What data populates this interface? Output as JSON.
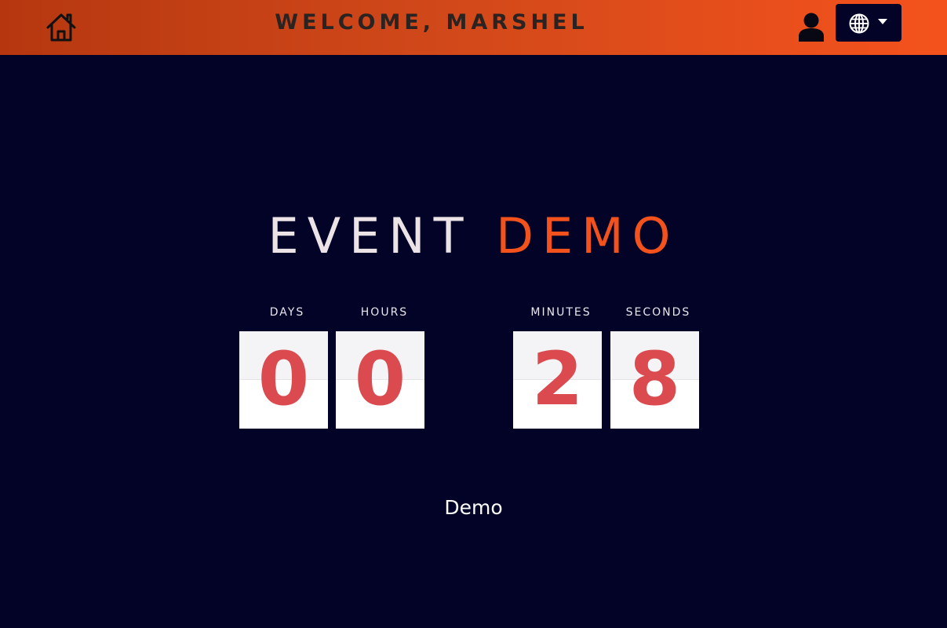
{
  "header": {
    "welcome_text": "WELCOME, MARSHEL",
    "home_icon": "home-icon",
    "user_icon": "user-icon",
    "language_icon": "globe-icon",
    "gradient_start": "#b6370f",
    "gradient_end": "#f4521c"
  },
  "event": {
    "title_part1": "EVENT",
    "title_part2": "DEMO",
    "accent_color": "#f4521c",
    "subtitle": "Demo"
  },
  "countdown": {
    "days_label": "DAYS",
    "hours_label": "HOURS",
    "minutes_label": "MINUTES",
    "seconds_label": "SECONDS",
    "days": "0",
    "hours": "0",
    "minutes": "2",
    "seconds": "8",
    "digit_color": "#da4a4f"
  },
  "theme": {
    "background": "#020326"
  }
}
